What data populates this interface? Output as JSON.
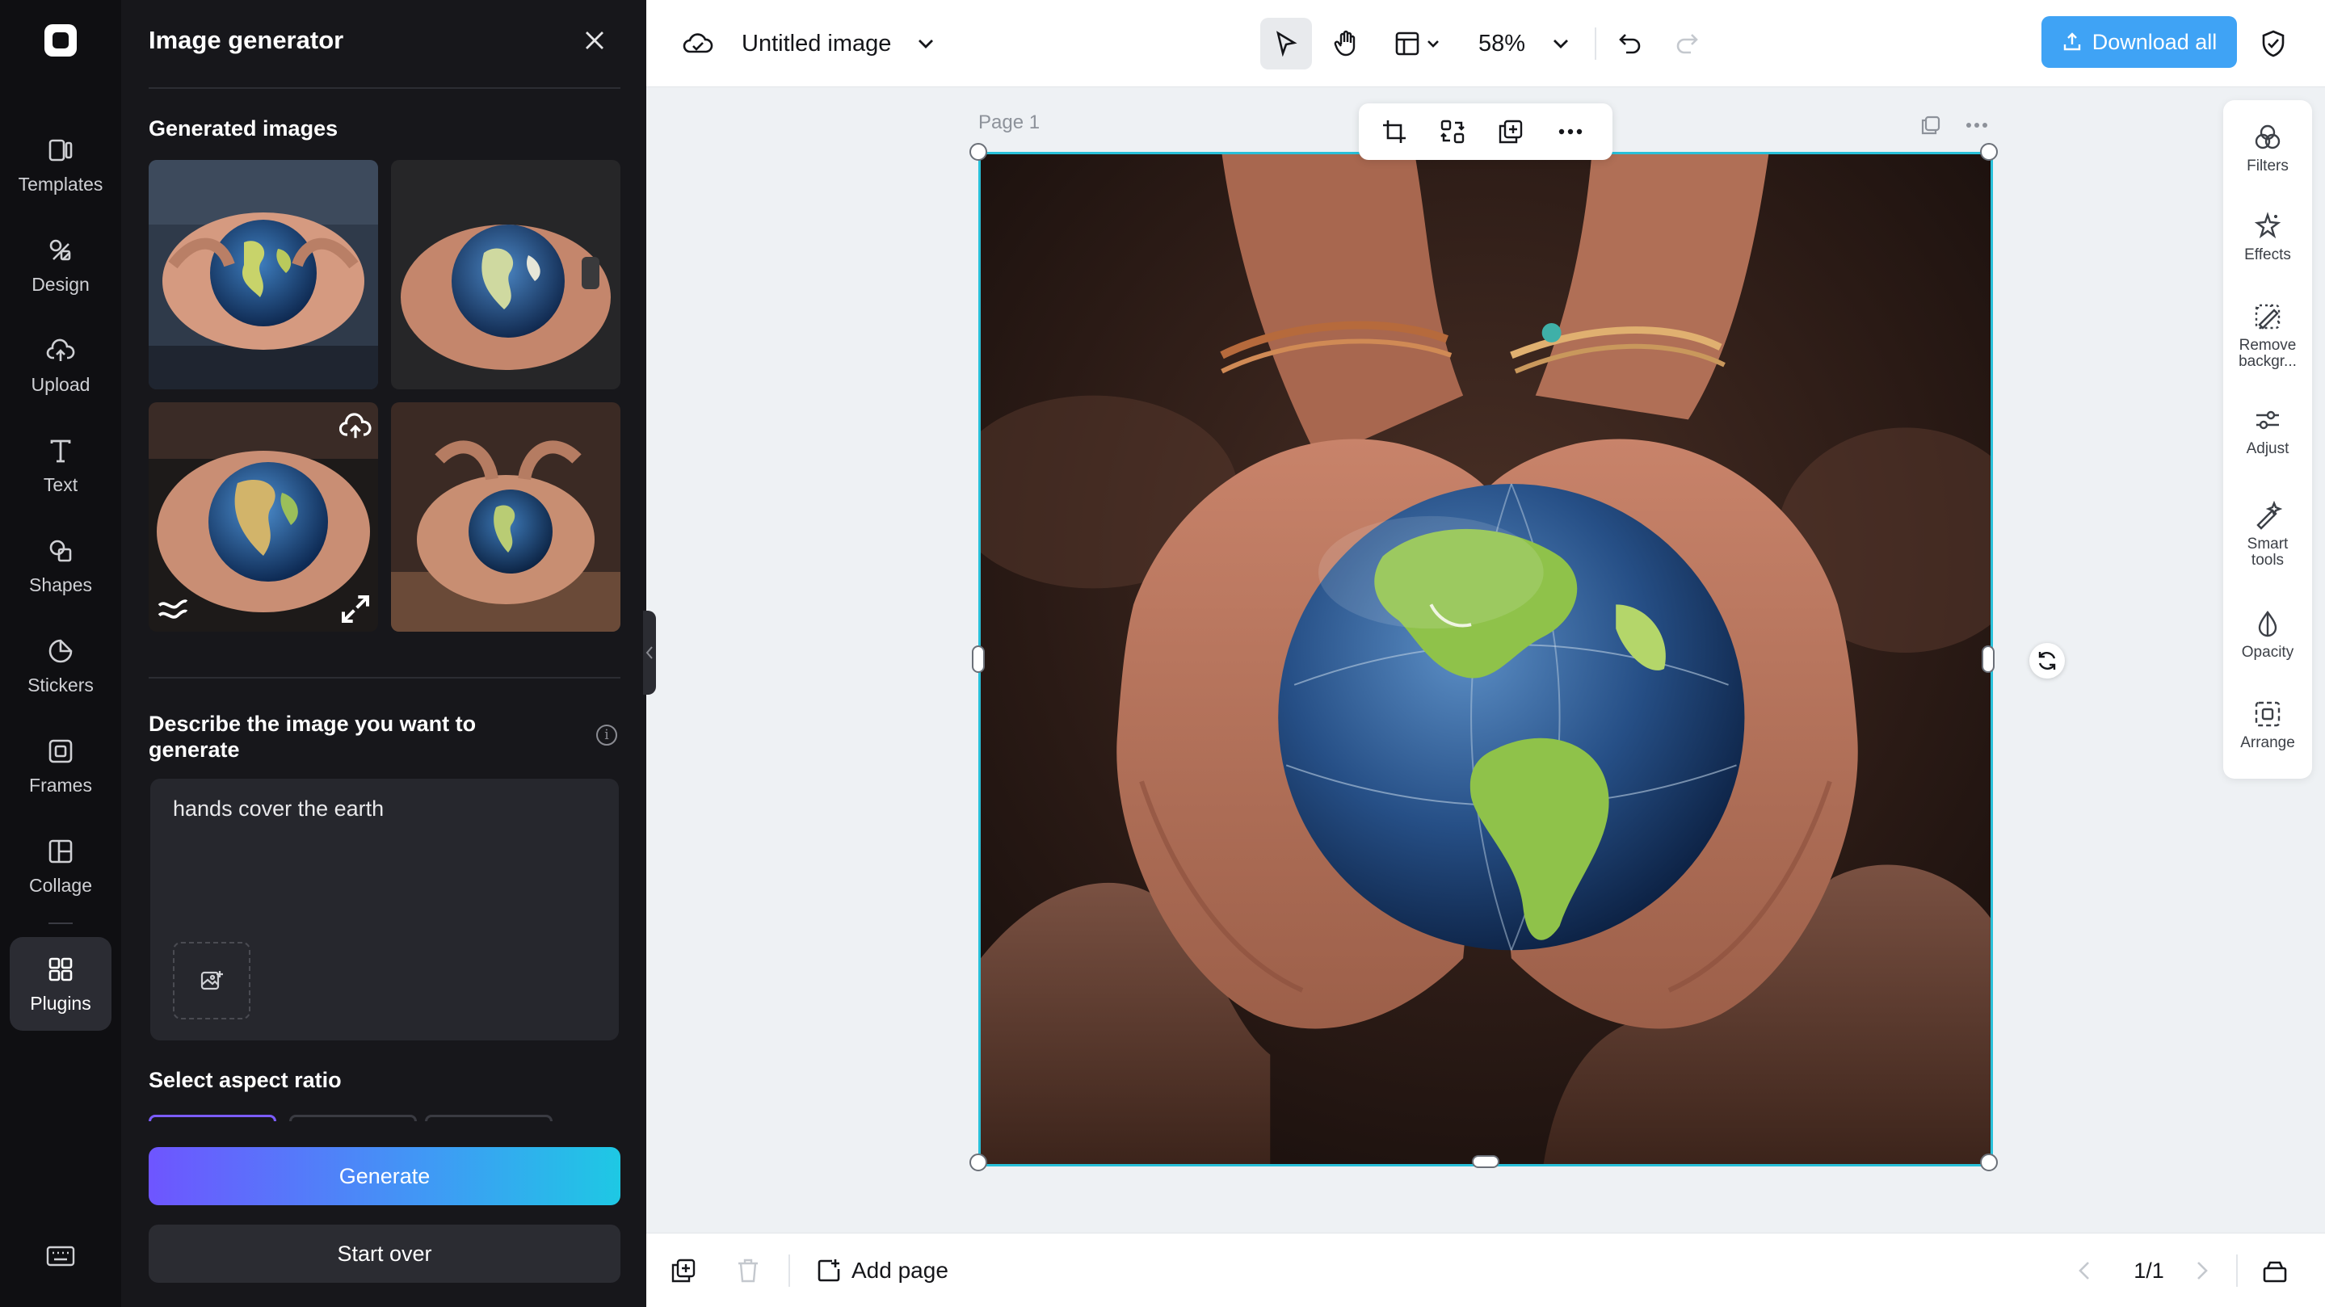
{
  "rail": {
    "items": [
      {
        "label": "Templates",
        "icon": "templates-icon"
      },
      {
        "label": "Design",
        "icon": "design-icon"
      },
      {
        "label": "Upload",
        "icon": "upload-icon"
      },
      {
        "label": "Text",
        "icon": "text-icon"
      },
      {
        "label": "Shapes",
        "icon": "shapes-icon"
      },
      {
        "label": "Stickers",
        "icon": "stickers-icon"
      },
      {
        "label": "Frames",
        "icon": "frames-icon"
      },
      {
        "label": "Collage",
        "icon": "collage-icon"
      },
      {
        "label": "Plugins",
        "icon": "plugins-icon",
        "active": true
      }
    ]
  },
  "panel": {
    "title": "Image generator",
    "generated_heading": "Generated images",
    "describe_label": "Describe the image you want to generate",
    "prompt_value": "hands cover the earth",
    "aspect_heading": "Select aspect ratio",
    "generate_label": "Generate",
    "start_over_label": "Start over"
  },
  "topbar": {
    "doc_title": "Untitled image",
    "zoom": "58%",
    "download_label": "Download all"
  },
  "canvas": {
    "page_label": "Page 1"
  },
  "tools": [
    {
      "label": "Filters",
      "icon": "filters-icon"
    },
    {
      "label": "Effects",
      "icon": "effects-icon"
    },
    {
      "label": "Remove backgr...",
      "icon": "remove-background-icon"
    },
    {
      "label": "Adjust",
      "icon": "adjust-icon"
    },
    {
      "label": "Smart tools",
      "icon": "smart-tools-icon"
    },
    {
      "label": "Opacity",
      "icon": "opacity-icon"
    },
    {
      "label": "Arrange",
      "icon": "arrange-icon"
    }
  ],
  "bottombar": {
    "add_page_label": "Add page",
    "pager": "1/1"
  },
  "colors": {
    "accent": "#28c0d9",
    "download": "#3fa3f5",
    "generate_start": "#6e55ff",
    "generate_end": "#1ec8e4",
    "ratio_selected": "#7b5cff"
  }
}
